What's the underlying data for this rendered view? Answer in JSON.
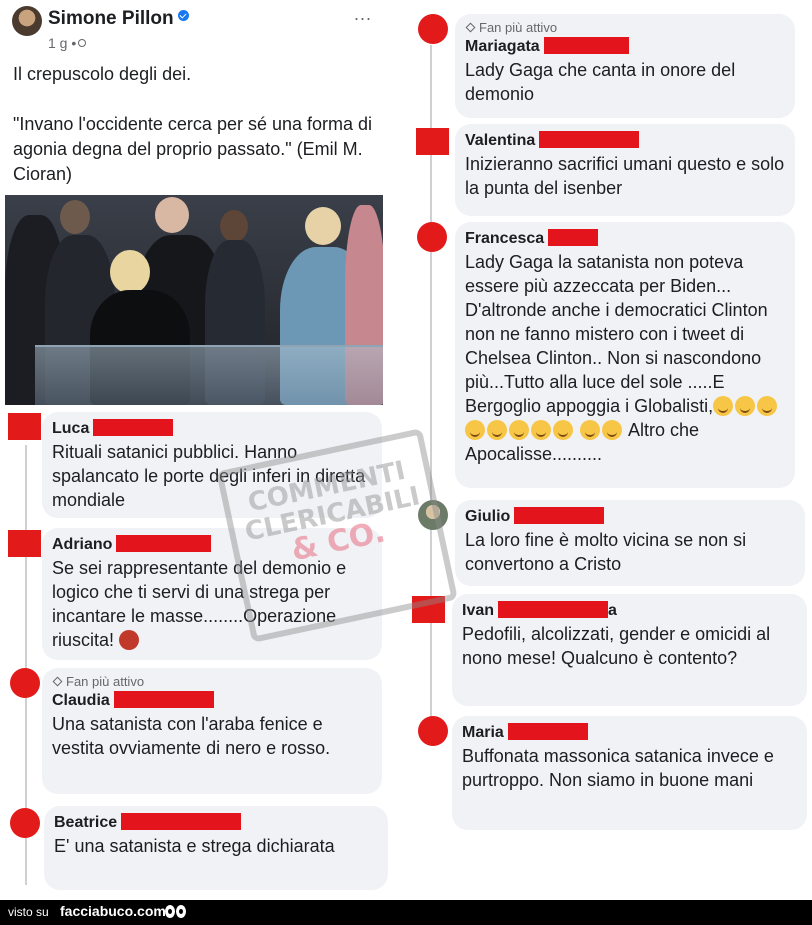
{
  "post": {
    "author": "Simone Pillon",
    "meta": "1 g •",
    "more": "...",
    "text_1": "Il crepuscolo degli dei.",
    "text_2": "\"Invano l'occidente cerca per sé una forma di agonia degna del proprio passato.\" (Emil M. Cioran)",
    "icons": [
      "verified-badge-icon",
      "globe-icon",
      "more-options-icon"
    ]
  },
  "comments_left": [
    {
      "name": "Luca",
      "text": "Rituali satanici pubblici. Hanno spalancato le porte degli inferi in diretta mondiale"
    },
    {
      "name": "Adriano",
      "text": "Se sei rappresentante del demonio e logico che ti servi di una strega per incantare le masse........Operazione riuscita!"
    },
    {
      "badge": "Fan più attivo",
      "name": "Claudia",
      "text": "Una satanista con l'araba fenice e vestita ovviamente di nero e rosso."
    },
    {
      "name": "Beatrice",
      "text": "E' una satanista e strega dichiarata"
    }
  ],
  "comments_right": [
    {
      "badge": "Fan più attivo",
      "name": "Mariagata",
      "text": "Lady Gaga che canta in onore del demonio"
    },
    {
      "name": "Valentina",
      "text": "Inizieranno sacrifici umani questo e solo la punta del isenber"
    },
    {
      "name": "Francesca",
      "text": "Lady Gaga la satanista non poteva essere più azzeccata per Biden... D'altronde anche i democratici Clinton non ne fanno mistero con i tweet di Chelsea Clinton.. Non si nascondono più...Tutto alla luce del sole .....E Bergoglio appoggia i Globalisti,",
      "text_end": "Altro che Apocalisse.........."
    },
    {
      "name": "Giulio",
      "text": "La loro fine è molto vicina se non si convertono a Cristo"
    },
    {
      "name": "Ivan",
      "name_suffix": "a",
      "text": "Pedofili, alcolizzati, gender e omicidi al nono mese! Qualcuno è contento?"
    },
    {
      "name": "Maria",
      "text": "Buffonata massonica satanica invece e purtroppo.  Non  siamo in buone mani"
    }
  ],
  "watermark": {
    "line1": "COMMENTI",
    "line2": "CLERICABILI",
    "line3": "& CO."
  },
  "footer": {
    "visto": "visto su",
    "site": "facciabuco.com"
  },
  "colors": {
    "redaction": "#e3141c",
    "bubble": "#f0f2f5",
    "verified": "#1877f2"
  }
}
